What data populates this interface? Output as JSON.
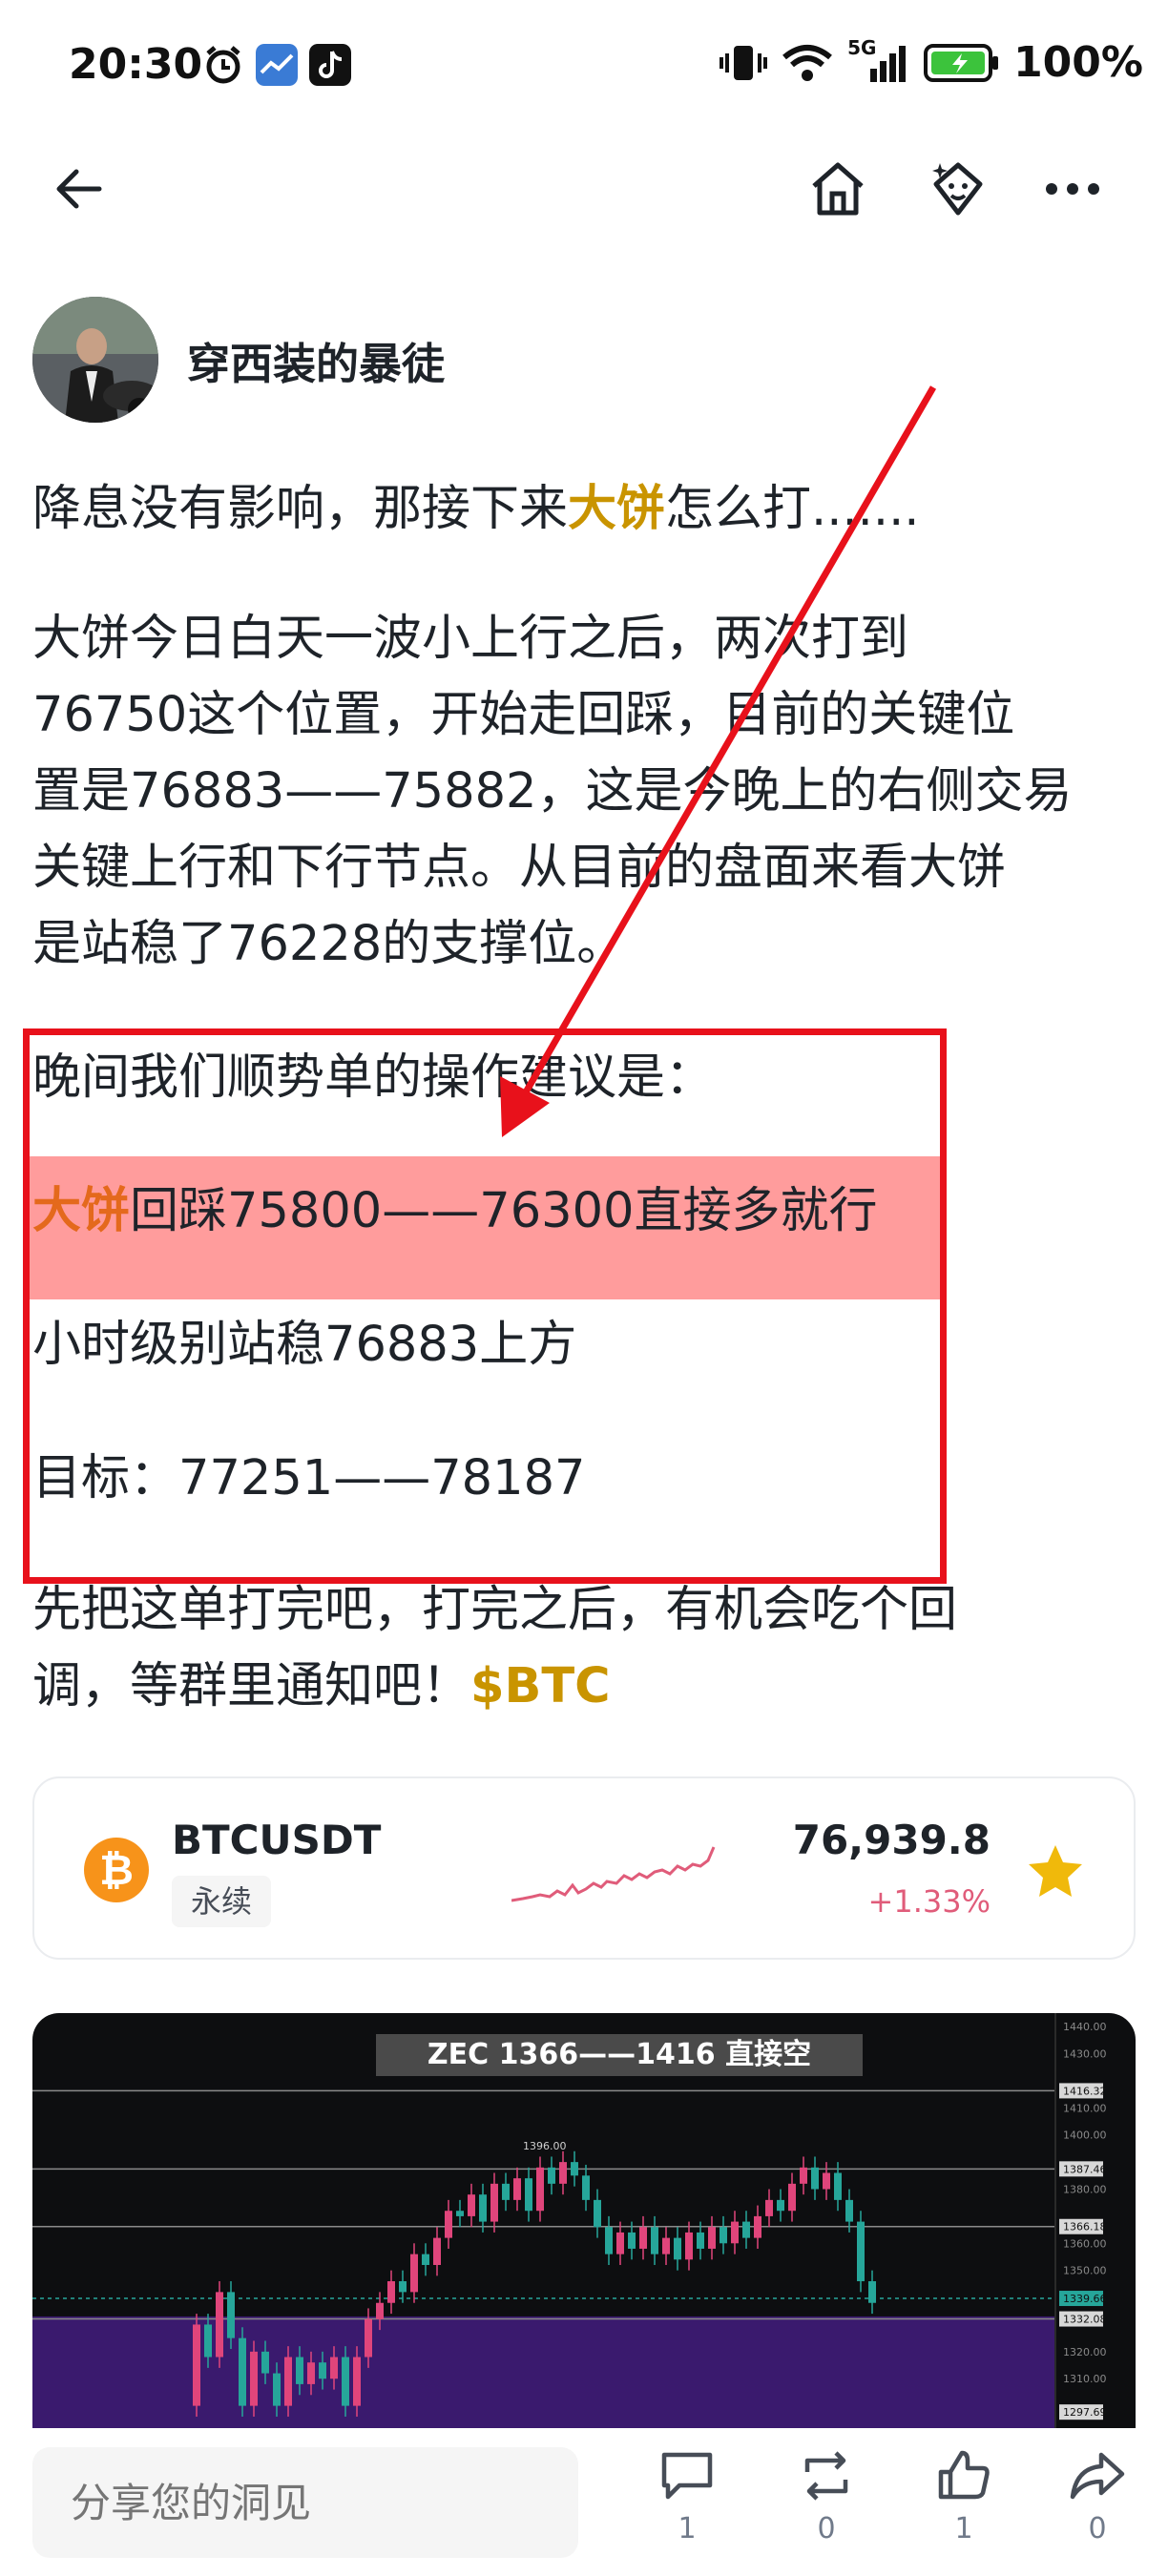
{
  "status_bar": {
    "time": "20:30",
    "network": "5G",
    "battery": "100%"
  },
  "nav": {
    "icons": [
      "back-arrow-icon",
      "home-icon",
      "ai-assistant-icon",
      "more-icon"
    ]
  },
  "author": {
    "name": "穿西装的暴徒"
  },
  "post": {
    "p1_a": "降息没有影响，那接下来",
    "p1_hl": "大饼",
    "p1_b": "怎么打.......",
    "p2_line1": "大饼今日白天一波小上行之后，两次打到",
    "p2_line2": "76750这个位置，开始走回踩，目前的关键位",
    "p2_line3": "置是76883——75882，这是今晚上的右侧交易",
    "p2_line4": "关键上行和下行节点。从目前的盘面来看大饼",
    "p2_line5": "是站稳了76228的支撑位。",
    "p3": "晚间我们顺势单的操作建议是：",
    "p4_hl": "大饼",
    "p4_rest": "回踩75800——76300直接多就行",
    "p5": "小时级别站稳76883上方",
    "p6": "目标：77251——78187",
    "p7_line1": "先把这单打完吧，打完之后，有机会吃个回",
    "p7_line2": "调，等群里通知吧！",
    "ticker": "$BTC"
  },
  "ticker_card": {
    "symbol": "BTCUSDT",
    "tag": "永续",
    "price": "76,939.8",
    "change": "+1.33%",
    "coin_glyph": "₿",
    "colors": {
      "coin": "#f7931a",
      "change": "#e05c7a",
      "star": "#f0b90b"
    }
  },
  "chart_image": {
    "title": "ZEC  1366——1416  直接空",
    "labels": [
      "1440.00",
      "1430.00",
      "1416.32",
      "1410.00",
      "1400.00",
      "1396.00",
      "1387.46",
      "1380.00",
      "1366.18",
      "1360.00",
      "1350.00",
      "1339.66",
      "1332.08",
      "1320.00",
      "1310.00",
      "1297.69"
    ]
  },
  "bottom_bar": {
    "comment_placeholder": "分享您的洞见",
    "comment_count": "1",
    "repost_count": "0",
    "like_count": "1",
    "share_count": "0"
  }
}
